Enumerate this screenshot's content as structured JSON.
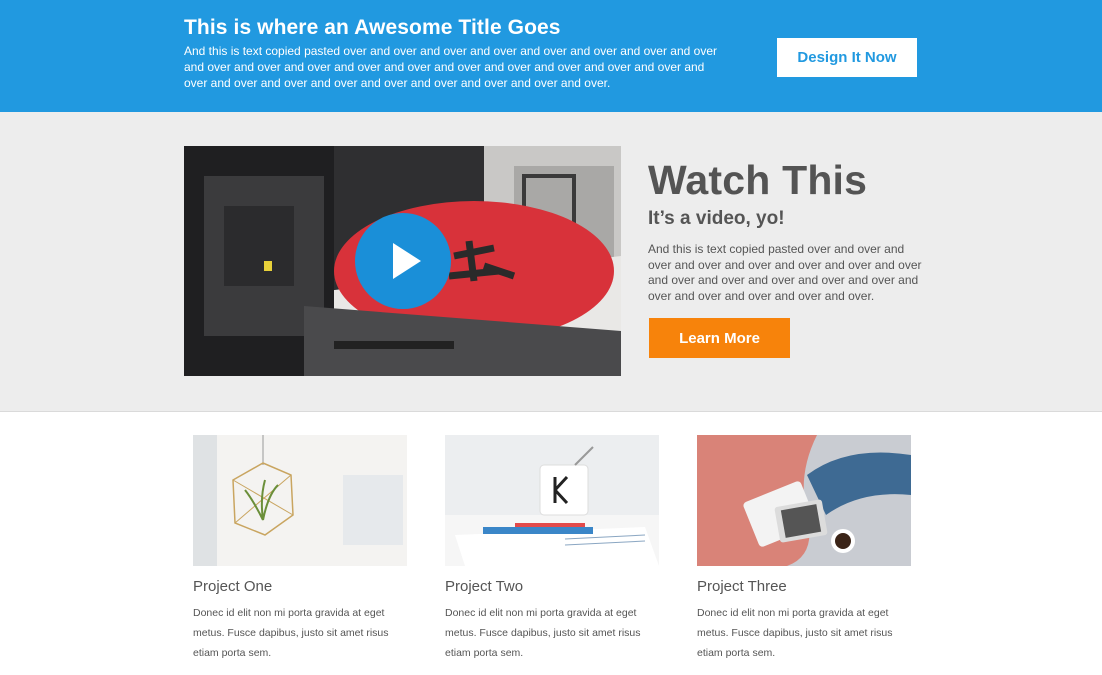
{
  "hero": {
    "title": "This is where an Awesome Title Goes",
    "text": "And this is text copied pasted over and over and over and over and over and over and over and over and over and over and over and over and over and over and over and over and over and over and over and over and over and over and over and over and over and over and over.",
    "button_label": "Design It Now"
  },
  "video_section": {
    "title": "Watch This",
    "subtitle": "It’s a video, yo!",
    "text": "And this is text copied pasted over and over and over and over and over and over and over and over and over and over and over and over and over and over and over and over and over and over.",
    "button_label": "Learn More"
  },
  "projects": [
    {
      "title": "Project One",
      "text": "Donec id elit non mi porta gravida at eget metus. Fusce dapibus, justo sit amet risus etiam porta sem."
    },
    {
      "title": "Project Two",
      "text": "Donec id elit non mi porta gravida at eget metus. Fusce dapibus, justo sit amet risus etiam porta sem."
    },
    {
      "title": "Project Three",
      "text": "Donec id elit non mi porta gravida at eget metus. Fusce dapibus, justo sit amet risus etiam porta sem."
    }
  ],
  "colors": {
    "hero_bg": "#2199e0",
    "band_bg": "#ededed",
    "accent_orange": "#f7830b",
    "play_blue": "#1a8fd8"
  },
  "icons": {
    "play": "play-icon"
  }
}
